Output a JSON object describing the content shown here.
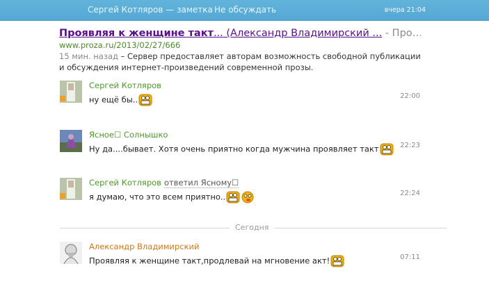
{
  "header": {
    "title": "Сергей Котляров — заметка",
    "unfollow": "Не обсуждать",
    "time": "вчера 21:04"
  },
  "result": {
    "title_bold": "Проявляя к женщине такт",
    "title_rest": "... (Александр Владимирский ...",
    "title_tail": " - Про…",
    "url": "www.proza.ru/2013/02/27/666",
    "ago": "15 мин. назад",
    "snippet": " – Сервер предоставляет авторам возможность свободной публикации и обсуждения интернет-произведений современной прозы."
  },
  "messages": [
    {
      "name": "Сергей Котляров",
      "text": "ну ещё бы..",
      "time": "22:00"
    },
    {
      "name": "Ясное☐ Солнышко",
      "text": "Ну да....бывает. Хотя очень приятно когда мужчина проявляет такт",
      "time": "22:23"
    },
    {
      "name": "Сергей Котляров",
      "reply": "ответил Ясному☐",
      "text": "я думаю, что это всем приятно..",
      "time": "22:24"
    },
    {
      "name": "Александр Владимирский",
      "text": "Проявляя к женщине такт,продлевай на мгновение акт!",
      "time": "07:11"
    }
  ],
  "divider_label": "Сегодня",
  "icons": {
    "smiley": "grin-smiley-icon",
    "wink": "tongue-smiley-icon"
  }
}
